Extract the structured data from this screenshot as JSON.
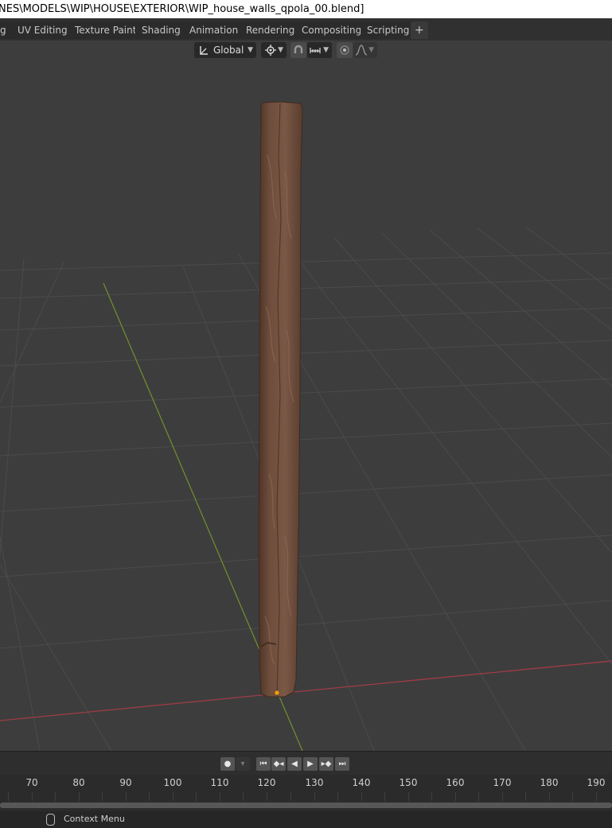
{
  "window": {
    "title": "NES\\MODELS\\WIP\\HOUSE\\EXTERIOR\\WIP_house_walls_qpola_00.blend]"
  },
  "workspace_tabs": [
    {
      "label": "g"
    },
    {
      "label": "UV Editing"
    },
    {
      "label": "Texture Paint"
    },
    {
      "label": "Shading"
    },
    {
      "label": "Animation"
    },
    {
      "label": "Rendering"
    },
    {
      "label": "Compositing"
    },
    {
      "label": "Scripting"
    },
    {
      "label": "+"
    }
  ],
  "header": {
    "transform_orientation": "Global",
    "icons": [
      "transform-orientation-icon",
      "pivot-point-icon",
      "snap-magnet-icon",
      "snap-increment-icon",
      "proportional-edit-icon",
      "falloff-curve-icon"
    ]
  },
  "viewport": {
    "object": "wooden-plank",
    "colors": {
      "background": "#3d3d3d",
      "grid": "#4a4a4a",
      "x_axis": "#a03c46",
      "y_axis": "#6e8c2e",
      "wood": "#6b4b3a",
      "origin": "#f5a000"
    }
  },
  "timeline": {
    "frames": [
      "70",
      "80",
      "90",
      "100",
      "110",
      "120",
      "130",
      "140",
      "150",
      "160",
      "170",
      "180",
      "190"
    ],
    "playback_icons": [
      "record-icon",
      "jump-start-icon",
      "prev-keyframe-icon",
      "play-reverse-icon",
      "play-icon",
      "next-keyframe-icon",
      "jump-end-icon"
    ]
  },
  "statusbar": {
    "context_menu": "Context Menu"
  }
}
